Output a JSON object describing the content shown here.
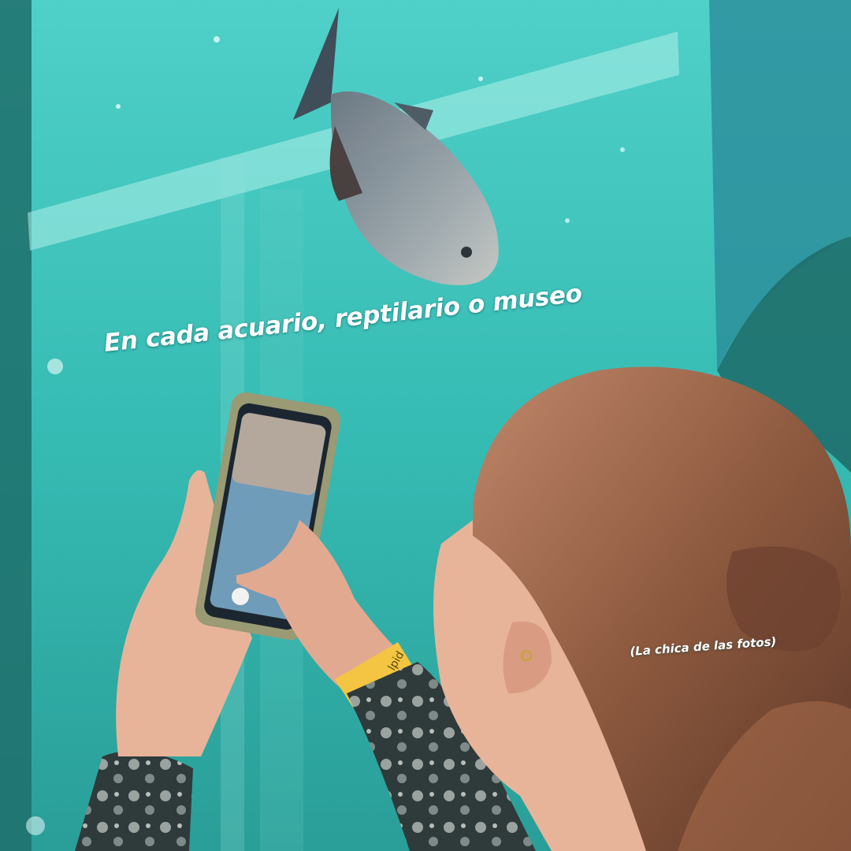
{
  "captions": {
    "main": "En cada acuario, reptilario o museo",
    "credit": "(La chica de las fotos)"
  },
  "scene": {
    "water_color": "#38bfb7",
    "deep_color": "#1f7f7b",
    "hair_color": "#9a6446",
    "skin_color": "#e7b49a",
    "wristband_color": "#f4c542",
    "phone_case_color": "#9a9a74",
    "wristband_text": "lpid"
  }
}
